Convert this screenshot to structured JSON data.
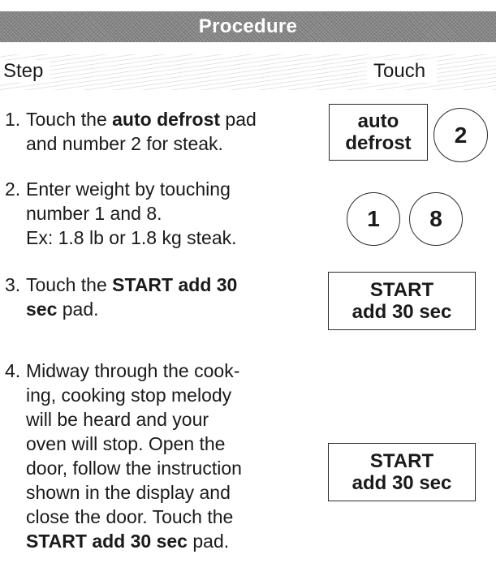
{
  "header": {
    "title": "Procedure",
    "step_label": "Step",
    "touch_label": "Touch"
  },
  "steps": [
    {
      "number": "1.",
      "lines": [
        {
          "pre": "Touch the ",
          "bold": "auto defrost",
          "post": " pad"
        },
        {
          "text": "and number 2 for steak."
        }
      ],
      "touch": {
        "pad_line1": "auto",
        "pad_line2": "defrost",
        "circle": "2"
      }
    },
    {
      "number": "2.",
      "lines": [
        {
          "text": "Enter weight by touching"
        },
        {
          "text": "number 1 and 8."
        },
        {
          "text": "Ex: 1.8 lb or 1.8 kg steak."
        }
      ],
      "touch": {
        "circle1": "1",
        "circle2": "8"
      }
    },
    {
      "number": "3.",
      "lines": [
        {
          "pre": "Touch the ",
          "bold": "START add 30",
          "post": ""
        },
        {
          "bold": "sec",
          "post": " pad."
        }
      ],
      "touch": {
        "pad_line1": "START",
        "pad_line2": "add 30 sec"
      }
    },
    {
      "number": "4.",
      "lines": [
        {
          "text": "Midway through the cook-"
        },
        {
          "text": "ing, cooking stop melody"
        },
        {
          "text": "will be heard and your"
        },
        {
          "text": "oven will stop. Open the"
        },
        {
          "text": "door,  follow the instruction"
        },
        {
          "text": "shown in the display and"
        },
        {
          "text": "close the door. Touch the"
        },
        {
          "bold": "START add 30 sec",
          "post": " pad."
        }
      ],
      "touch": {
        "pad_line1": "START",
        "pad_line2": "add 30 sec"
      }
    }
  ]
}
